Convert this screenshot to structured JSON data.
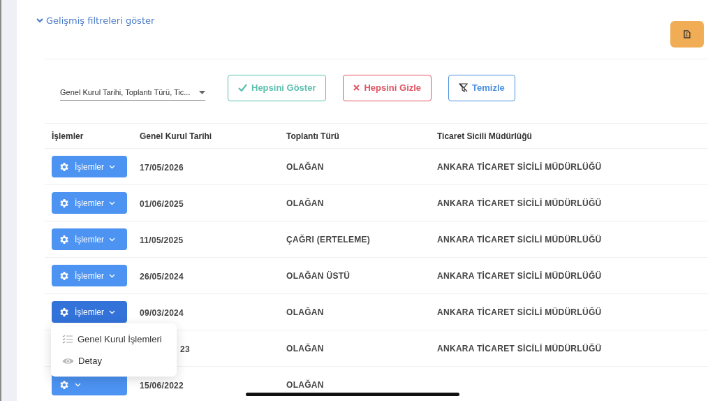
{
  "advanced_filters_link": {
    "label": "Gelişmiş filtreleri göster",
    "expanded": false
  },
  "column_select": {
    "value": "Genel Kurul Tarihi, Toplantı Türü, Tic..."
  },
  "buttons": [
    {
      "kind": "show",
      "label": "Hepsini Göster"
    },
    {
      "kind": "hide",
      "label": "Hepsini Gizle"
    },
    {
      "kind": "clear",
      "label": "Temizle"
    }
  ],
  "table": {
    "columns": [
      "İşlemler",
      "Genel Kurul Tarihi",
      "Toplantı Türü",
      "Ticaret Sicili Müdürlüğü"
    ],
    "rows": [
      {
        "actions": {
          "label": "İşlemler",
          "open": false
        },
        "date": "17/05/2026",
        "type": "OLAĞAN",
        "registry": "ANKARA TİCARET SİCİLİ MÜDÜRLÜĞÜ"
      },
      {
        "actions": {
          "label": "İşlemler",
          "open": false
        },
        "date": "01/06/2025",
        "type": "OLAĞAN",
        "registry": "ANKARA TİCARET SİCİLİ MÜDÜRLÜĞÜ"
      },
      {
        "actions": {
          "label": "İşlemler",
          "open": false
        },
        "date": "11/05/2025",
        "type": "ÇAĞRI (ERTELEME)",
        "registry": "ANKARA TİCARET SİCİLİ MÜDÜRLÜĞÜ"
      },
      {
        "actions": {
          "label": "İşlemler",
          "open": false
        },
        "date": "26/05/2024",
        "type": "OLAĞAN ÜSTÜ",
        "registry": "ANKARA TİCARET SİCİLİ MÜDÜRLÜĞÜ"
      },
      {
        "actions": {
          "label": "İşlemler",
          "open": true
        },
        "date": "09/03/2024",
        "type": "OLAĞAN",
        "registry": "ANKARA TİCARET SİCİLİ MÜDÜRLÜĞÜ"
      },
      {
        "date": "23",
        "type": "OLAĞAN",
        "registry": "ANKARA TİCARET SİCİLİ MÜDÜRLÜĞÜ"
      },
      {
        "actions": {
          "open": false
        },
        "date": "15/06/2022",
        "type": "OLAĞAN"
      }
    ]
  },
  "actions_menu": {
    "items": [
      {
        "kind": "list",
        "label": "Genel Kurul İşlemleri"
      },
      {
        "kind": "view",
        "label": "Detay"
      }
    ]
  }
}
